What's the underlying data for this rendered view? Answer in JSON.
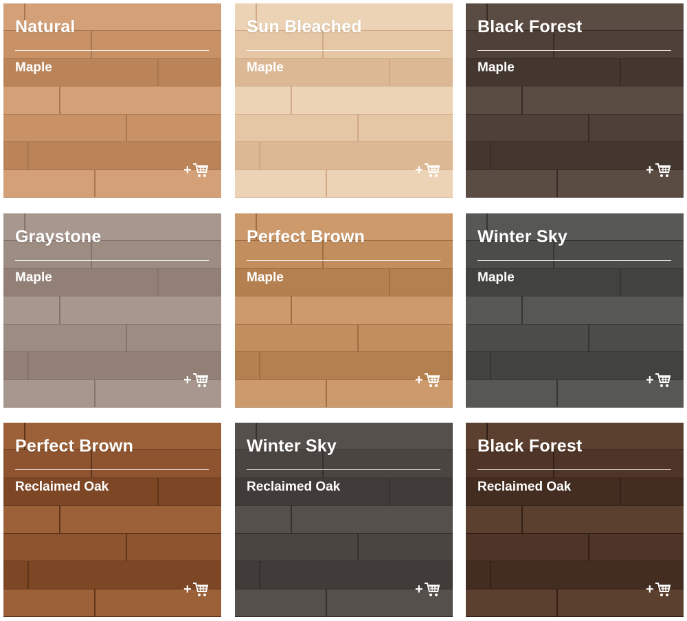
{
  "products": [
    {
      "name": "Natural",
      "species": "Maple",
      "base": "#c99266",
      "light": "#d4a077",
      "dark": "#ba8358",
      "seam": "#a8764f"
    },
    {
      "name": "Sun Bleached",
      "species": "Maple",
      "base": "#e6c7a5",
      "light": "#edd3b5",
      "dark": "#dcb895",
      "seam": "#cfa885"
    },
    {
      "name": "Black Forest",
      "species": "Maple",
      "base": "#4f4139",
      "light": "#5b4c43",
      "dark": "#44372f",
      "seam": "#362b25"
    },
    {
      "name": "Graystone",
      "species": "Maple",
      "base": "#9d8c82",
      "light": "#a7978e",
      "dark": "#928076",
      "seam": "#85736a"
    },
    {
      "name": "Perfect Brown",
      "species": "Maple",
      "base": "#c38e5e",
      "light": "#cd9a6c",
      "dark": "#b58050",
      "seam": "#9f6d42"
    },
    {
      "name": "Winter Sky",
      "species": "Maple",
      "base": "#4c4d4a",
      "light": "#575855",
      "dark": "#42433f",
      "seam": "#353633"
    },
    {
      "name": "Perfect Brown",
      "species": "Reclaimed Oak",
      "base": "#8e5430",
      "light": "#9c6139",
      "dark": "#7d4726",
      "seam": "#5e3419"
    },
    {
      "name": "Winter Sky",
      "species": "Reclaimed Oak",
      "base": "#4b4542",
      "light": "#55504c",
      "dark": "#413c39",
      "seam": "#34302d"
    },
    {
      "name": "Black Forest",
      "species": "Reclaimed Oak",
      "base": "#4f3527",
      "light": "#5b3f2f",
      "dark": "#432c20",
      "seam": "#331f16"
    }
  ]
}
